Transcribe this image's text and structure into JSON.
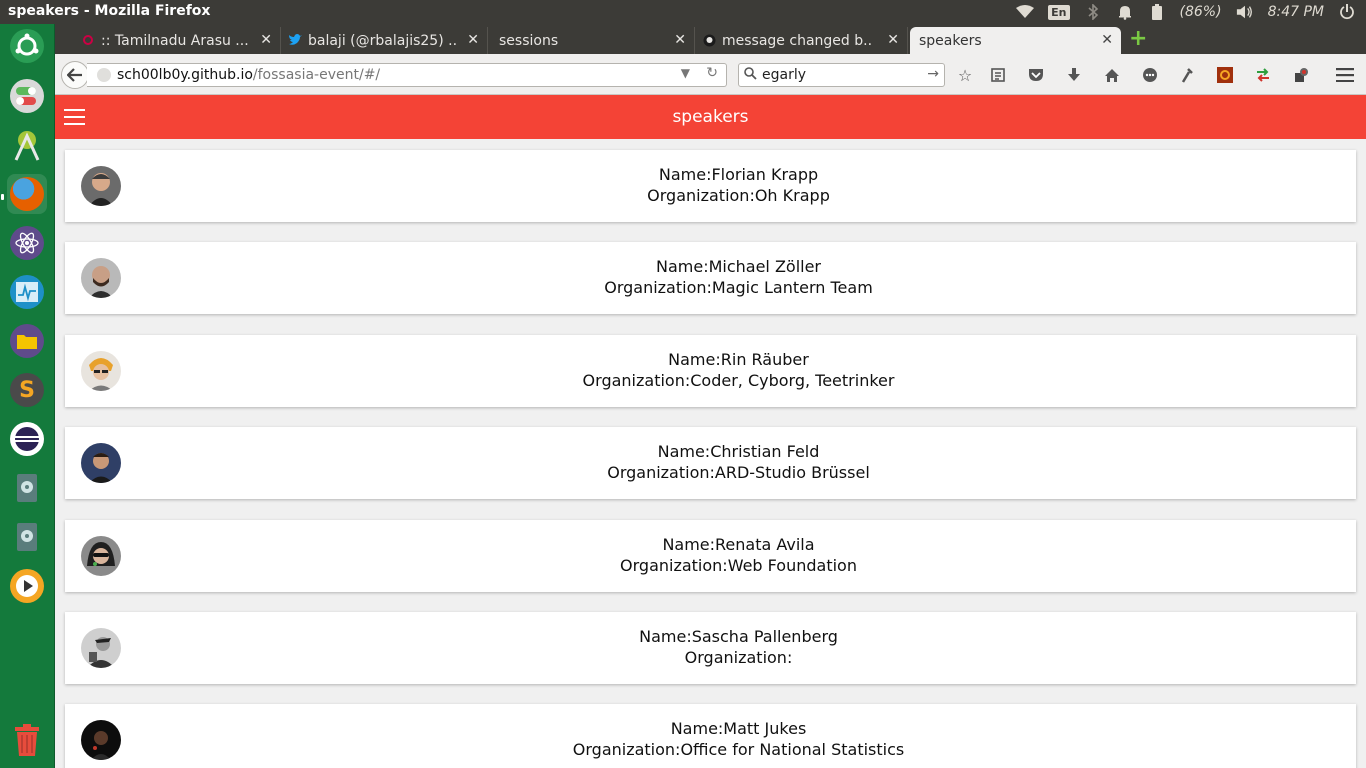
{
  "system": {
    "window_title": "speakers - Mozilla Firefox",
    "lang": "En",
    "battery": "(86%)",
    "clock": "8:47 PM"
  },
  "tabs": [
    {
      "label": ":: Tamilnadu Arasu ...",
      "favicon": "tn-icon"
    },
    {
      "label": "balaji (@rbalajis25) ...",
      "favicon": "twitter-icon"
    },
    {
      "label": "sessions",
      "favicon": ""
    },
    {
      "label": "message changed b...",
      "favicon": "github-icon"
    },
    {
      "label": "speakers",
      "favicon": "",
      "active": true
    }
  ],
  "nav": {
    "url_host": "sch00lb0y.github.io",
    "url_path": "/fossasia-event/#/",
    "search_value": "egarly"
  },
  "app": {
    "title": "speakers",
    "header_color": "#f44336"
  },
  "speakers": [
    {
      "name": "Name:Florian Krapp",
      "org": "Organization:Oh Krapp"
    },
    {
      "name": "Name:Michael Zöller",
      "org": "Organization:Magic Lantern Team"
    },
    {
      "name": "Name:Rin Räuber",
      "org": "Organization:Coder, Cyborg, Teetrinker"
    },
    {
      "name": "Name:Christian Feld",
      "org": "Organization:ARD-Studio Brüssel"
    },
    {
      "name": "Name:Renata Avila",
      "org": "Organization:Web Foundation"
    },
    {
      "name": "Name:Sascha Pallenberg",
      "org": "Organization:"
    },
    {
      "name": "Name:Matt Jukes",
      "org": "Organization:Office for National Statistics"
    }
  ]
}
